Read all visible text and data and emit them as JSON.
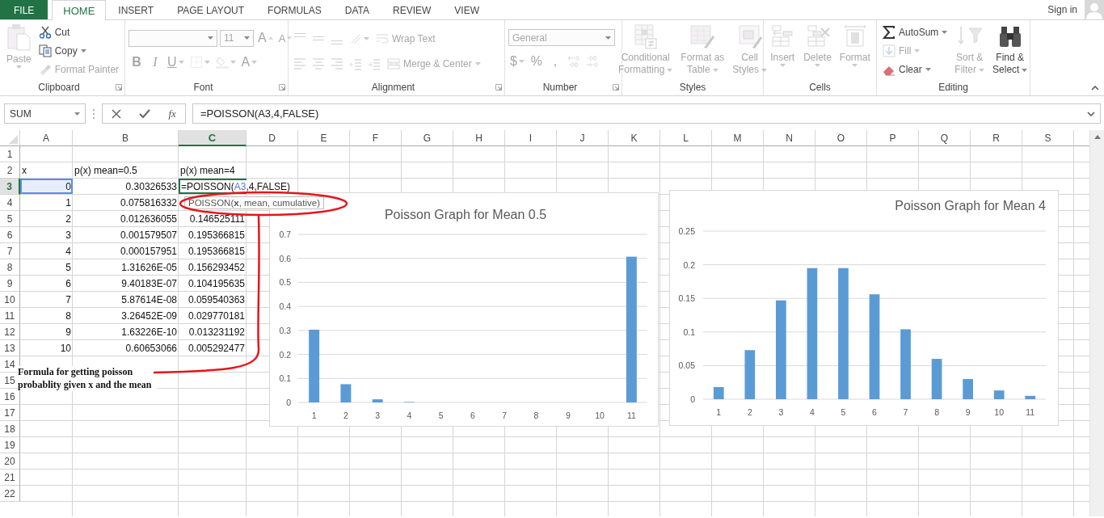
{
  "tabs": [
    {
      "label": "FILE",
      "kind": "file",
      "selected": false
    },
    {
      "label": "HOME",
      "kind": "tab",
      "selected": true
    },
    {
      "label": "INSERT",
      "kind": "tab",
      "selected": false
    },
    {
      "label": "PAGE LAYOUT",
      "kind": "tab",
      "selected": false
    },
    {
      "label": "FORMULAS",
      "kind": "tab",
      "selected": false
    },
    {
      "label": "DATA",
      "kind": "tab",
      "selected": false
    },
    {
      "label": "REVIEW",
      "kind": "tab",
      "selected": false
    },
    {
      "label": "VIEW",
      "kind": "tab",
      "selected": false
    }
  ],
  "account": {
    "label": "Sign in"
  },
  "ribbon": {
    "groups": [
      {
        "label": "Clipboard",
        "launcher": true,
        "items": [
          {
            "kind": "large",
            "lines": [
              "Paste"
            ],
            "disabled": true,
            "dropdown": true
          },
          {
            "kind": "small",
            "label": "Cut",
            "disabled": false,
            "dropdown": false
          },
          {
            "kind": "small",
            "label": "Copy",
            "disabled": false,
            "dropdown": true
          },
          {
            "kind": "small",
            "label": "Format Painter",
            "disabled": true,
            "dropdown": false
          }
        ]
      },
      {
        "label": "Font",
        "launcher": true,
        "rows": [
          [
            {
              "kind": "field",
              "disabled": true,
              "dropdown": true
            },
            {
              "kind": "field",
              "value": "11",
              "disabled": true,
              "dropdown": true
            },
            {
              "kind": "tool",
              "label": "A",
              "disabled": true,
              "dropdown": false
            },
            {
              "kind": "tool",
              "label": "A",
              "disabled": true,
              "dropdown": false
            }
          ],
          [
            {
              "kind": "tool",
              "label": "B",
              "disabled": true,
              "dropdown": false
            },
            {
              "kind": "tool",
              "label": "I",
              "disabled": true,
              "dropdown": false
            },
            {
              "kind": "tool",
              "label": "U",
              "disabled": true,
              "dropdown": true
            },
            {
              "kind": "tool",
              "disabled": true,
              "dropdown": true
            },
            {
              "kind": "tool",
              "disabled": true,
              "dropdown": true
            },
            {
              "kind": "tool",
              "label": "A",
              "disabled": true,
              "dropdown": true
            }
          ]
        ]
      },
      {
        "label": "Alignment",
        "launcher": true,
        "rows": [
          [
            {
              "kind": "tool",
              "disabled": true,
              "dropdown": false
            },
            {
              "kind": "tool",
              "disabled": true,
              "dropdown": false
            },
            {
              "kind": "tool",
              "disabled": true,
              "dropdown": false
            },
            {
              "kind": "tool",
              "disabled": true,
              "dropdown": true
            },
            {
              "kind": "small",
              "label": "Wrap Text",
              "disabled": true,
              "dropdown": false
            }
          ],
          [
            {
              "kind": "tool",
              "disabled": true,
              "dropdown": false
            },
            {
              "kind": "tool",
              "disabled": true,
              "dropdown": false
            },
            {
              "kind": "tool",
              "disabled": true,
              "dropdown": false
            },
            {
              "kind": "tool",
              "disabled": true,
              "dropdown": false
            },
            {
              "kind": "tool",
              "disabled": true,
              "dropdown": false
            },
            {
              "kind": "small",
              "label": "Merge & Center",
              "disabled": true,
              "dropdown": true
            }
          ]
        ]
      },
      {
        "label": "Number",
        "launcher": true,
        "rows": [
          [
            {
              "kind": "field",
              "value": "General",
              "disabled": true,
              "dropdown": true
            }
          ],
          [
            {
              "kind": "tool",
              "label": "$",
              "disabled": true,
              "dropdown": true
            },
            {
              "kind": "tool",
              "label": "%",
              "disabled": true,
              "dropdown": false
            },
            {
              "kind": "tool",
              "label": ",",
              "disabled": true,
              "dropdown": false
            },
            {
              "kind": "tool",
              "disabled": true,
              "dropdown": false
            },
            {
              "kind": "tool",
              "disabled": true,
              "dropdown": false
            }
          ]
        ]
      },
      {
        "label": "Styles",
        "launcher": false,
        "items": [
          {
            "kind": "large",
            "lines": [
              "Conditional",
              "Formatting"
            ],
            "disabled": true,
            "dropdown": true
          },
          {
            "kind": "large",
            "lines": [
              "Format as",
              "Table"
            ],
            "disabled": true,
            "dropdown": true
          },
          {
            "kind": "large",
            "lines": [
              "Cell",
              "Styles"
            ],
            "disabled": true,
            "dropdown": true
          }
        ]
      },
      {
        "label": "Cells",
        "launcher": false,
        "items": [
          {
            "kind": "large",
            "lines": [
              "Insert"
            ],
            "disabled": true,
            "dropdown": true
          },
          {
            "kind": "large",
            "lines": [
              "Delete"
            ],
            "disabled": true,
            "dropdown": true
          },
          {
            "kind": "large",
            "lines": [
              "Format"
            ],
            "disabled": true,
            "dropdown": true
          }
        ]
      },
      {
        "label": "Editing",
        "launcher": false,
        "items": [
          {
            "kind": "small",
            "label": "AutoSum",
            "disabled": false,
            "dropdown": true
          },
          {
            "kind": "small",
            "label": "Fill",
            "disabled": true,
            "dropdown": true
          },
          {
            "kind": "small",
            "label": "Clear",
            "disabled": false,
            "dropdown": true
          },
          {
            "kind": "large",
            "lines": [
              "Sort &",
              "Filter"
            ],
            "disabled": true,
            "dropdown": true
          },
          {
            "kind": "large",
            "lines": [
              "Find &",
              "Select"
            ],
            "disabled": false,
            "dropdown": true
          }
        ]
      }
    ]
  },
  "formula_bar": {
    "name_box": "SUM",
    "function_label": "fx",
    "formula": "=POISSON(A3,4,FALSE)"
  },
  "sheet": {
    "columns": [
      {
        "label": "A",
        "selected": false
      },
      {
        "label": "B",
        "selected": false
      },
      {
        "label": "C",
        "selected": true
      },
      {
        "label": "D",
        "selected": false
      },
      {
        "label": "E",
        "selected": false
      },
      {
        "label": "F",
        "selected": false
      },
      {
        "label": "G",
        "selected": false
      },
      {
        "label": "H",
        "selected": false
      },
      {
        "label": "I",
        "selected": false
      },
      {
        "label": "J",
        "selected": false
      },
      {
        "label": "K",
        "selected": false
      },
      {
        "label": "L",
        "selected": false
      },
      {
        "label": "M",
        "selected": false
      },
      {
        "label": "N",
        "selected": false
      },
      {
        "label": "O",
        "selected": false
      },
      {
        "label": "P",
        "selected": false
      },
      {
        "label": "Q",
        "selected": false
      },
      {
        "label": "R",
        "selected": false
      },
      {
        "label": "S",
        "selected": false
      }
    ],
    "rows": [
      {
        "label": "1",
        "selected": false
      },
      {
        "label": "2",
        "selected": false,
        "kind": "text",
        "cells": [
          "x",
          "p(x) mean=0.5",
          "p(x) mean=4"
        ]
      },
      {
        "label": "3",
        "selected": true,
        "kind": "number",
        "cells": [
          {
            "value": "0",
            "referenced": true
          },
          "0.30326533",
          {
            "kind": "editor",
            "before": "=POISSON(",
            "reference": "A3",
            "after": ",4,FALSE)"
          }
        ]
      },
      {
        "label": "4",
        "selected": false,
        "kind": "number",
        "cells": [
          "1",
          "0.075816332"
        ]
      },
      {
        "label": "5",
        "selected": false,
        "kind": "number",
        "cells": [
          "2",
          "0.012636055",
          "0.146525111"
        ]
      },
      {
        "label": "6",
        "selected": false,
        "kind": "number",
        "cells": [
          "3",
          "0.001579507",
          "0.195366815"
        ]
      },
      {
        "label": "7",
        "selected": false,
        "kind": "number",
        "cells": [
          "4",
          "0.000157951",
          "0.195366815"
        ]
      },
      {
        "label": "8",
        "selected": false,
        "kind": "number",
        "cells": [
          "5",
          "1.31626E-05",
          "0.156293452"
        ]
      },
      {
        "label": "9",
        "selected": false,
        "kind": "number",
        "cells": [
          "6",
          "9.40183E-07",
          "0.104195635"
        ]
      },
      {
        "label": "10",
        "selected": false,
        "kind": "number",
        "cells": [
          "7",
          "5.87614E-08",
          "0.059540363"
        ]
      },
      {
        "label": "11",
        "selected": false,
        "kind": "number",
        "cells": [
          "8",
          "3.26452E-09",
          "0.029770181"
        ]
      },
      {
        "label": "12",
        "selected": false,
        "kind": "number",
        "cells": [
          "9",
          "1.63226E-10",
          "0.013231192"
        ]
      },
      {
        "label": "13",
        "selected": false,
        "kind": "number",
        "cells": [
          "10",
          "0.60653066",
          "0.005292477"
        ]
      },
      {
        "label": "14",
        "selected": false
      },
      {
        "label": "15",
        "selected": false
      },
      {
        "label": "16",
        "selected": false
      },
      {
        "label": "17",
        "selected": false
      },
      {
        "label": "18",
        "selected": false
      },
      {
        "label": "19",
        "selected": false
      },
      {
        "label": "20",
        "selected": false
      },
      {
        "label": "21",
        "selected": false
      },
      {
        "label": "22",
        "selected": false
      }
    ],
    "tooltip": "POISSON(**x**, mean, cumulative)",
    "annotation": {
      "text": "Formula for getting poisson probablity given x and the mean"
    },
    "charts": [
      {
        "chart_data": {
          "type": "bar",
          "title": "Poisson Graph for Mean 0.5",
          "categories": [
            "1",
            "2",
            "3",
            "4",
            "5",
            "6",
            "7",
            "8",
            "9",
            "10",
            "11"
          ],
          "series": [
            {
              "color": "#5b9bd5",
              "values": [
                0.303,
                0.076,
                0.013,
                0.002,
                0,
                0,
                0,
                0,
                0,
                0,
                0.607
              ]
            }
          ],
          "grid": true,
          "ylim": [
            0,
            0.7
          ],
          "yticks": [
            0,
            0.1,
            0.2,
            0.3,
            0.4,
            0.5,
            0.6,
            0.7
          ]
        }
      },
      {
        "chart_data": {
          "type": "bar",
          "title": "Poisson Graph for Mean 4",
          "categories": [
            "1",
            "2",
            "3",
            "4",
            "5",
            "6",
            "7",
            "8",
            "9",
            "10",
            "11"
          ],
          "series": [
            {
              "color": "#5b9bd5",
              "values": [
                0.018,
                0.073,
                0.147,
                0.195,
                0.195,
                0.156,
                0.104,
                0.06,
                0.03,
                0.013,
                0.005
              ]
            }
          ],
          "grid": true,
          "ylim": [
            0,
            0.25
          ],
          "yticks": [
            0,
            0.05,
            0.1,
            0.15,
            0.2,
            0.25
          ]
        }
      }
    ]
  }
}
